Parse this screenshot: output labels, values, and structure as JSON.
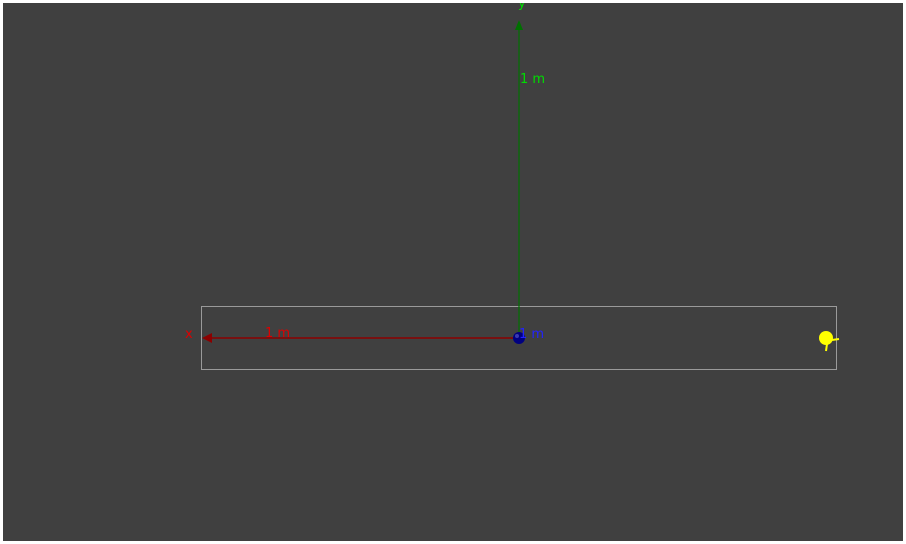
{
  "scene": {
    "background_color": "#404040",
    "bounding_box_color": "#9a9a9a",
    "light_color": "#ffff00"
  },
  "axes": {
    "x": {
      "label": "x",
      "scale_label": "1 m",
      "axis_color": "#8b0000",
      "text_color": "#dd0000"
    },
    "y": {
      "label": "y",
      "scale_label": "1 m",
      "axis_color": "#007000",
      "text_color": "#00dd00"
    },
    "z": {
      "scale_label": "1 m",
      "axis_color": "#000080",
      "text_color": "#2222ff"
    }
  },
  "icons": {
    "light": "point-light-icon",
    "origin": "origin-sphere-icon"
  }
}
